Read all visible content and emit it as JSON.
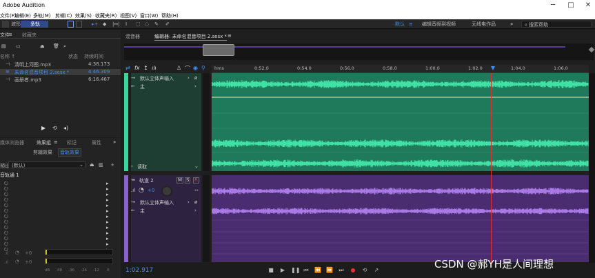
{
  "window": {
    "title": "Adobe Audition",
    "minimize": "─",
    "maximize": "□",
    "close": "✕"
  },
  "menu": [
    "文件(F)",
    "编辑(E)",
    "多轨(M)",
    "剪辑(C)",
    "效果(S)",
    "收藏夹(R)",
    "视图(V)",
    "窗口(W)",
    "帮助(H)"
  ],
  "toolbar": {
    "waveform": "波形",
    "multitrack": "多轨",
    "workspace_default": "默认",
    "workspace_menu": "≡",
    "workspace_edit_video": "编辑音频到视频",
    "workspace_radio": "无线电作品",
    "more": "»",
    "search_placeholder": "搜索帮助"
  },
  "files_panel": {
    "tab_files": "文件",
    "tab_menu": "≡",
    "tab_favorites": "收藏夹",
    "header_name": "名称 ↑",
    "header_status": "状态",
    "header_duration": "持续时间",
    "items": [
      {
        "name": "清明上河图.mp3",
        "duration": "4:38.173",
        "selected": false,
        "highlight": false
      },
      {
        "name": "未命名混音项目 2.sesx *",
        "duration": "4:46.309",
        "selected": true,
        "highlight": true
      },
      {
        "name": "画册者.mp3",
        "duration": "6:16.467",
        "selected": false,
        "highlight": false
      }
    ]
  },
  "effects_panel": {
    "tab_browser": "媒体浏览器",
    "tab_effects": "效果组",
    "tab_menu": "≡",
    "tab_markers": "标记",
    "tab_properties": "属性",
    "more": "»",
    "sub_tab_clip": "剪辑效果",
    "sub_tab_track": "音轨效果",
    "preset_label": "预设:",
    "preset_value": "(默认)",
    "track_label": "音轨通 1",
    "db_scale": [
      "dB",
      "-48",
      "-36",
      "-24",
      "-12",
      "0"
    ],
    "meter_value": "+0"
  },
  "editor": {
    "tab_mixer": "混音器",
    "tab_editor": "编辑器: 未命名混音项目 2.sesx *",
    "tab_menu": "≡",
    "ruler_first": "hms",
    "ruler_ticks": [
      "0:52.0",
      "0:54.0",
      "0:56.0",
      "0:58.0",
      "1:00.0",
      "1:02.0",
      "1:04.0",
      "1:06.0"
    ],
    "track1": {
      "input": "默认立体声输入",
      "output": "主",
      "mode": "读取"
    },
    "track2": {
      "name": "轨道 2",
      "m": "M",
      "s": "S",
      "r": "R",
      "volume": "+0",
      "input": "默认立体声输入",
      "output": "主"
    }
  },
  "transport": {
    "time": "1:02.917"
  },
  "watermark": "CSDN @郝YH是人间理想",
  "colors": {
    "track1_lane": "#1e7a5a",
    "track1_wave": "#41e0a6",
    "track2_lane": "#4a2c70",
    "track2_wave": "#a97ae6",
    "accent_blue": "#3f8ff6",
    "playhead": "#e03030"
  }
}
